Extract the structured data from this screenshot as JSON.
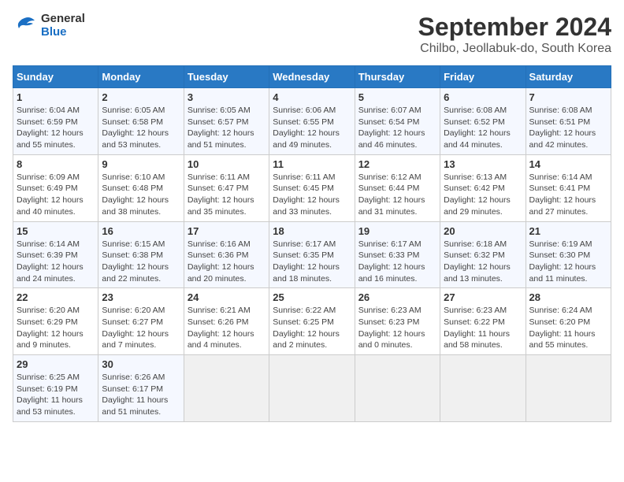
{
  "header": {
    "logo_line1": "General",
    "logo_line2": "Blue",
    "title": "September 2024",
    "subtitle": "Chilbo, Jeollabuk-do, South Korea"
  },
  "weekdays": [
    "Sunday",
    "Monday",
    "Tuesday",
    "Wednesday",
    "Thursday",
    "Friday",
    "Saturday"
  ],
  "weeks": [
    [
      {
        "day": "1",
        "sunrise": "6:04 AM",
        "sunset": "6:59 PM",
        "daylight": "12 hours and 55 minutes."
      },
      {
        "day": "2",
        "sunrise": "6:05 AM",
        "sunset": "6:58 PM",
        "daylight": "12 hours and 53 minutes."
      },
      {
        "day": "3",
        "sunrise": "6:05 AM",
        "sunset": "6:57 PM",
        "daylight": "12 hours and 51 minutes."
      },
      {
        "day": "4",
        "sunrise": "6:06 AM",
        "sunset": "6:55 PM",
        "daylight": "12 hours and 49 minutes."
      },
      {
        "day": "5",
        "sunrise": "6:07 AM",
        "sunset": "6:54 PM",
        "daylight": "12 hours and 46 minutes."
      },
      {
        "day": "6",
        "sunrise": "6:08 AM",
        "sunset": "6:52 PM",
        "daylight": "12 hours and 44 minutes."
      },
      {
        "day": "7",
        "sunrise": "6:08 AM",
        "sunset": "6:51 PM",
        "daylight": "12 hours and 42 minutes."
      }
    ],
    [
      {
        "day": "8",
        "sunrise": "6:09 AM",
        "sunset": "6:49 PM",
        "daylight": "12 hours and 40 minutes."
      },
      {
        "day": "9",
        "sunrise": "6:10 AM",
        "sunset": "6:48 PM",
        "daylight": "12 hours and 38 minutes."
      },
      {
        "day": "10",
        "sunrise": "6:11 AM",
        "sunset": "6:47 PM",
        "daylight": "12 hours and 35 minutes."
      },
      {
        "day": "11",
        "sunrise": "6:11 AM",
        "sunset": "6:45 PM",
        "daylight": "12 hours and 33 minutes."
      },
      {
        "day": "12",
        "sunrise": "6:12 AM",
        "sunset": "6:44 PM",
        "daylight": "12 hours and 31 minutes."
      },
      {
        "day": "13",
        "sunrise": "6:13 AM",
        "sunset": "6:42 PM",
        "daylight": "12 hours and 29 minutes."
      },
      {
        "day": "14",
        "sunrise": "6:14 AM",
        "sunset": "6:41 PM",
        "daylight": "12 hours and 27 minutes."
      }
    ],
    [
      {
        "day": "15",
        "sunrise": "6:14 AM",
        "sunset": "6:39 PM",
        "daylight": "12 hours and 24 minutes."
      },
      {
        "day": "16",
        "sunrise": "6:15 AM",
        "sunset": "6:38 PM",
        "daylight": "12 hours and 22 minutes."
      },
      {
        "day": "17",
        "sunrise": "6:16 AM",
        "sunset": "6:36 PM",
        "daylight": "12 hours and 20 minutes."
      },
      {
        "day": "18",
        "sunrise": "6:17 AM",
        "sunset": "6:35 PM",
        "daylight": "12 hours and 18 minutes."
      },
      {
        "day": "19",
        "sunrise": "6:17 AM",
        "sunset": "6:33 PM",
        "daylight": "12 hours and 16 minutes."
      },
      {
        "day": "20",
        "sunrise": "6:18 AM",
        "sunset": "6:32 PM",
        "daylight": "12 hours and 13 minutes."
      },
      {
        "day": "21",
        "sunrise": "6:19 AM",
        "sunset": "6:30 PM",
        "daylight": "12 hours and 11 minutes."
      }
    ],
    [
      {
        "day": "22",
        "sunrise": "6:20 AM",
        "sunset": "6:29 PM",
        "daylight": "12 hours and 9 minutes."
      },
      {
        "day": "23",
        "sunrise": "6:20 AM",
        "sunset": "6:27 PM",
        "daylight": "12 hours and 7 minutes."
      },
      {
        "day": "24",
        "sunrise": "6:21 AM",
        "sunset": "6:26 PM",
        "daylight": "12 hours and 4 minutes."
      },
      {
        "day": "25",
        "sunrise": "6:22 AM",
        "sunset": "6:25 PM",
        "daylight": "12 hours and 2 minutes."
      },
      {
        "day": "26",
        "sunrise": "6:23 AM",
        "sunset": "6:23 PM",
        "daylight": "12 hours and 0 minutes."
      },
      {
        "day": "27",
        "sunrise": "6:23 AM",
        "sunset": "6:22 PM",
        "daylight": "11 hours and 58 minutes."
      },
      {
        "day": "28",
        "sunrise": "6:24 AM",
        "sunset": "6:20 PM",
        "daylight": "11 hours and 55 minutes."
      }
    ],
    [
      {
        "day": "29",
        "sunrise": "6:25 AM",
        "sunset": "6:19 PM",
        "daylight": "11 hours and 53 minutes."
      },
      {
        "day": "30",
        "sunrise": "6:26 AM",
        "sunset": "6:17 PM",
        "daylight": "11 hours and 51 minutes."
      },
      {
        "day": "",
        "sunrise": "",
        "sunset": "",
        "daylight": ""
      },
      {
        "day": "",
        "sunrise": "",
        "sunset": "",
        "daylight": ""
      },
      {
        "day": "",
        "sunrise": "",
        "sunset": "",
        "daylight": ""
      },
      {
        "day": "",
        "sunrise": "",
        "sunset": "",
        "daylight": ""
      },
      {
        "day": "",
        "sunrise": "",
        "sunset": "",
        "daylight": ""
      }
    ]
  ]
}
